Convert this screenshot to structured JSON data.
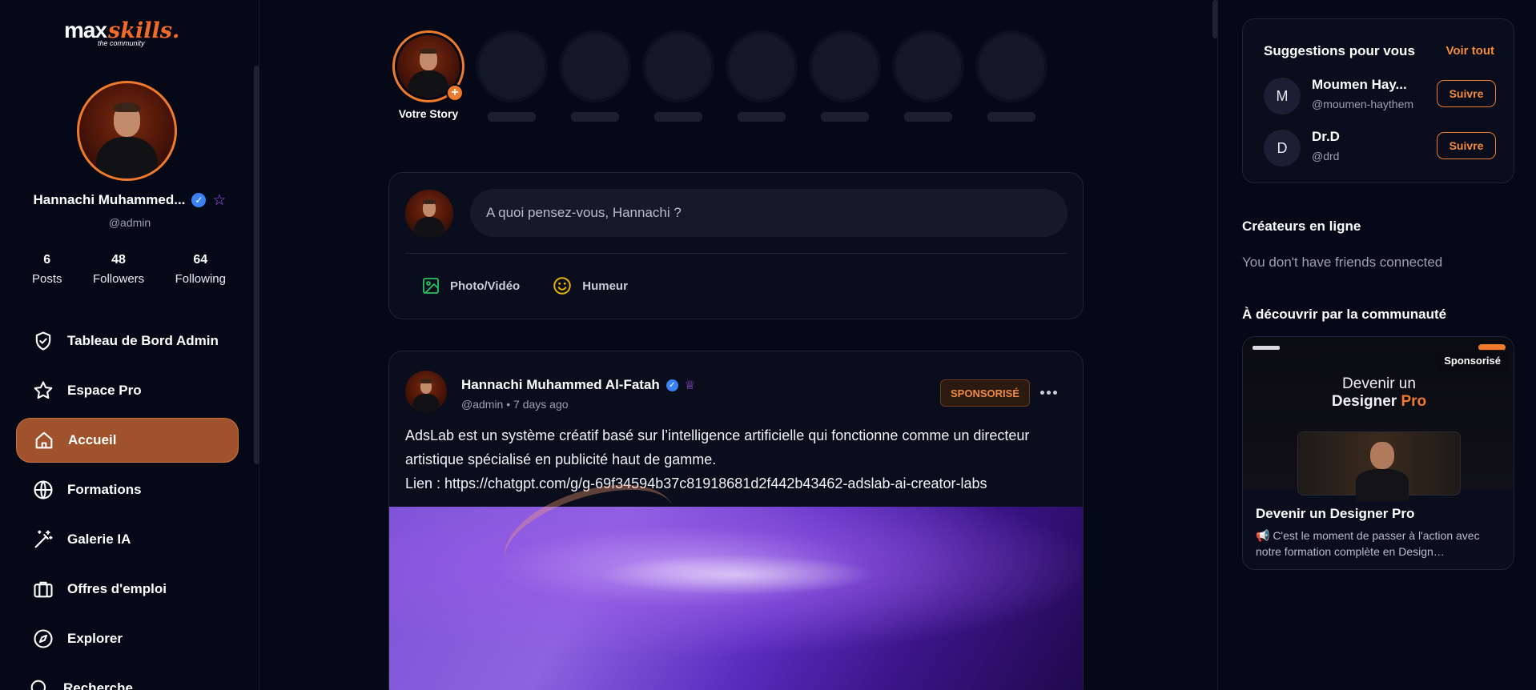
{
  "brand": {
    "name_part1": "max",
    "name_part2": "skills.",
    "tagline": "the community"
  },
  "profile": {
    "name": "Hannachi Muhammed...",
    "handle": "@admin",
    "verified_icon": "✓",
    "stats": [
      {
        "value": "6",
        "label": "Posts"
      },
      {
        "value": "48",
        "label": "Followers"
      },
      {
        "value": "64",
        "label": "Following"
      }
    ]
  },
  "nav": {
    "items": [
      {
        "label": "Tableau de Bord Admin",
        "icon": "shield-check-icon"
      },
      {
        "label": "Espace Pro",
        "icon": "star-icon"
      },
      {
        "label": "Accueil",
        "icon": "home-icon",
        "active": true
      },
      {
        "label": "Formations",
        "icon": "globe-icon"
      },
      {
        "label": "Galerie IA",
        "icon": "magic-wand-icon"
      },
      {
        "label": "Offres d'emploi",
        "icon": "briefcase-icon"
      },
      {
        "label": "Explorer",
        "icon": "compass-icon"
      },
      {
        "label": "Recherche",
        "icon": "search-icon"
      }
    ]
  },
  "stories": {
    "own_label": "Votre Story",
    "plus": "+",
    "placeholder_count": 7
  },
  "composer": {
    "placeholder": "A quoi pensez-vous, Hannachi ?",
    "actions": [
      {
        "label": "Photo/Vidéo",
        "icon": "image-icon"
      },
      {
        "label": "Humeur",
        "icon": "smiley-icon"
      }
    ]
  },
  "post": {
    "author": "Hannachi Muhammed Al-Fatah",
    "meta": "@admin • 7 days ago",
    "badge": "SPONSORISÉ",
    "body_line1": "AdsLab est un système créatif basé sur l’intelligence artificielle qui fonctionne comme un directeur",
    "body_line2": "artistique spécialisé en publicité haut de gamme.",
    "body_line3": "Lien : https://chatgpt.com/g/g-69f34594b37c81918681d2f442b43462-adslab-ai-creator-labs"
  },
  "suggestions": {
    "title": "Suggestions pour vous",
    "see_all": "Voir tout",
    "people": [
      {
        "initial": "M",
        "name": "Moumen Hay...",
        "handle": "@moumen-haythem",
        "button": "Suivre"
      },
      {
        "initial": "D",
        "name": "Dr.D",
        "handle": "@drd",
        "button": "Suivre"
      }
    ]
  },
  "online": {
    "title": "Créateurs en ligne",
    "empty": "You don't have friends connected"
  },
  "discover": {
    "title": "À découvrir par la communauté",
    "card": {
      "badge": "Sponsorisé",
      "image_heading_line1": "Devenir un",
      "image_heading_word": "Designer",
      "image_heading_accent": "Pro",
      "title": "Devenir un Designer Pro",
      "desc": "📢 C'est le moment de passer à l'action avec notre formation complète en Design…"
    }
  },
  "colors": {
    "accent": "#f07a2c",
    "background": "#050816",
    "card": "#0a0d1b",
    "active_nav": "#a0522d",
    "verified": "#3b82f6",
    "premium": "#a855f7"
  }
}
